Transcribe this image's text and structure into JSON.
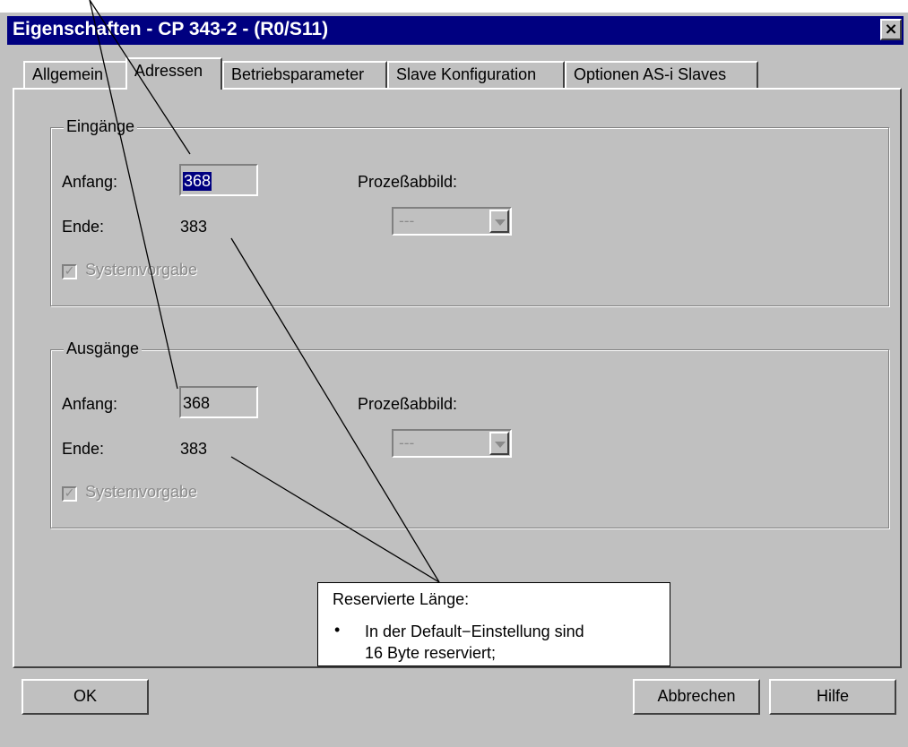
{
  "window": {
    "title": "Eigenschaften - CP 343-2 - (R0/S11)",
    "close_icon": "×"
  },
  "tabs": [
    {
      "label": "Allgemein"
    },
    {
      "label": "Adressen"
    },
    {
      "label": "Betriebsparameter"
    },
    {
      "label": "Slave Konfiguration"
    },
    {
      "label": "Optionen AS-i Slaves"
    }
  ],
  "inputs_group": {
    "title": "Eingänge",
    "start_label": "Anfang:",
    "start_value": "368",
    "end_label": "Ende:",
    "end_value": "383",
    "process_image_label": "Prozeßabbild:",
    "process_image_value": "---",
    "default_label": "Systemvorgabe",
    "default_checked": true
  },
  "outputs_group": {
    "title": "Ausgänge",
    "start_label": "Anfang:",
    "start_value": "368",
    "end_label": "Ende:",
    "end_value": "383",
    "process_image_label": "Prozeßabbild:",
    "process_image_value": "---",
    "default_label": "Systemvorgabe",
    "default_checked": true
  },
  "buttons": {
    "ok": "OK",
    "cancel": "Abbrechen",
    "help": "Hilfe"
  },
  "callout": {
    "title": "Reservierte Länge:",
    "bullet": "•",
    "line1": "In der Default−Einstellung sind",
    "line2": "16 Byte reserviert;"
  },
  "colors": {
    "titlebar": "#000080",
    "dialog_face": "#c0c0c0",
    "selection": "#000080"
  }
}
